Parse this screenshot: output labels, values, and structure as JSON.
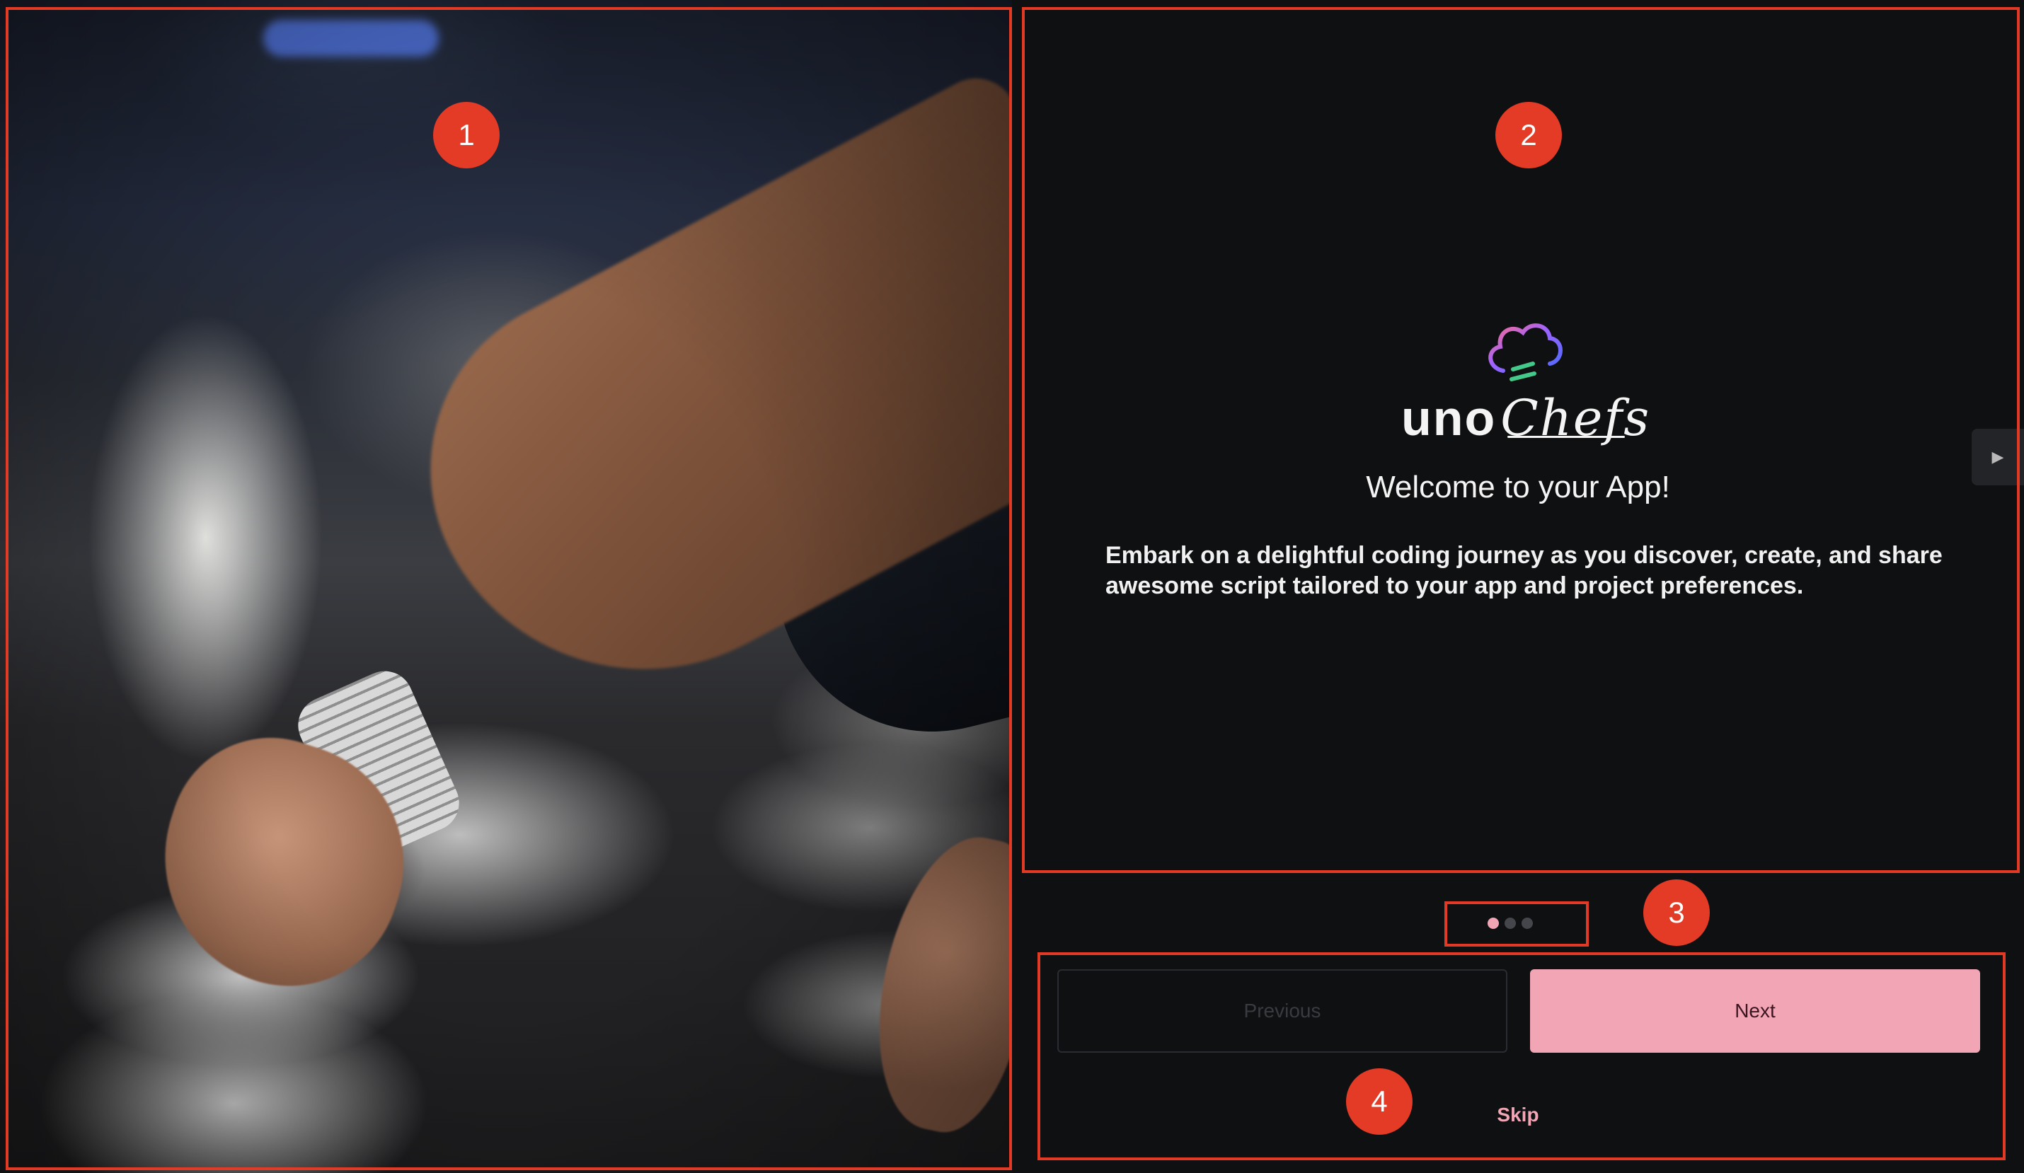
{
  "brand": {
    "logo_primary": "uno",
    "logo_script": "Chefs"
  },
  "onboarding": {
    "welcome_title": "Welcome to your App!",
    "description": "Embark on a delightful coding journey as you discover, create, and share awesome script tailored to your app and project preferences.",
    "pager": {
      "count": 3,
      "active_index": 0
    },
    "buttons": {
      "previous": "Previous",
      "next": "Next",
      "skip": "Skip"
    }
  },
  "annotations": [
    "1",
    "2",
    "3",
    "4"
  ],
  "icons": {
    "logo": "chef-hat-icon",
    "side_nav": "chevron-right-icon"
  },
  "colors": {
    "background": "#0f1012",
    "accent": "#f1a5b5",
    "annotation": "#e23b25",
    "disabled": "#3a3b40"
  }
}
